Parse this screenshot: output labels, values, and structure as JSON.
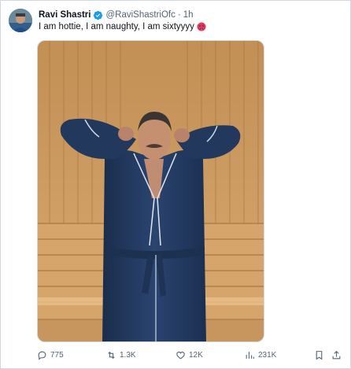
{
  "tweet": {
    "author_name": "Ravi Shastri",
    "handle": "@RaviShastriOfc",
    "separator": "·",
    "time": "1h",
    "text": "I am hottie, I am naughty, I am sixtyyyy",
    "emoji": "hot-face-emoji",
    "verified": true
  },
  "media": {
    "subject": "man-in-blue-bathrobe-photo"
  },
  "actions": {
    "replies": "775",
    "retweets": "1.3K",
    "likes": "12K",
    "views": "231K"
  },
  "colors": {
    "verified_blue": "#1d9bf0",
    "muted_text": "#536471",
    "robe_navy": "#22385c",
    "wood": "#c8985e"
  }
}
